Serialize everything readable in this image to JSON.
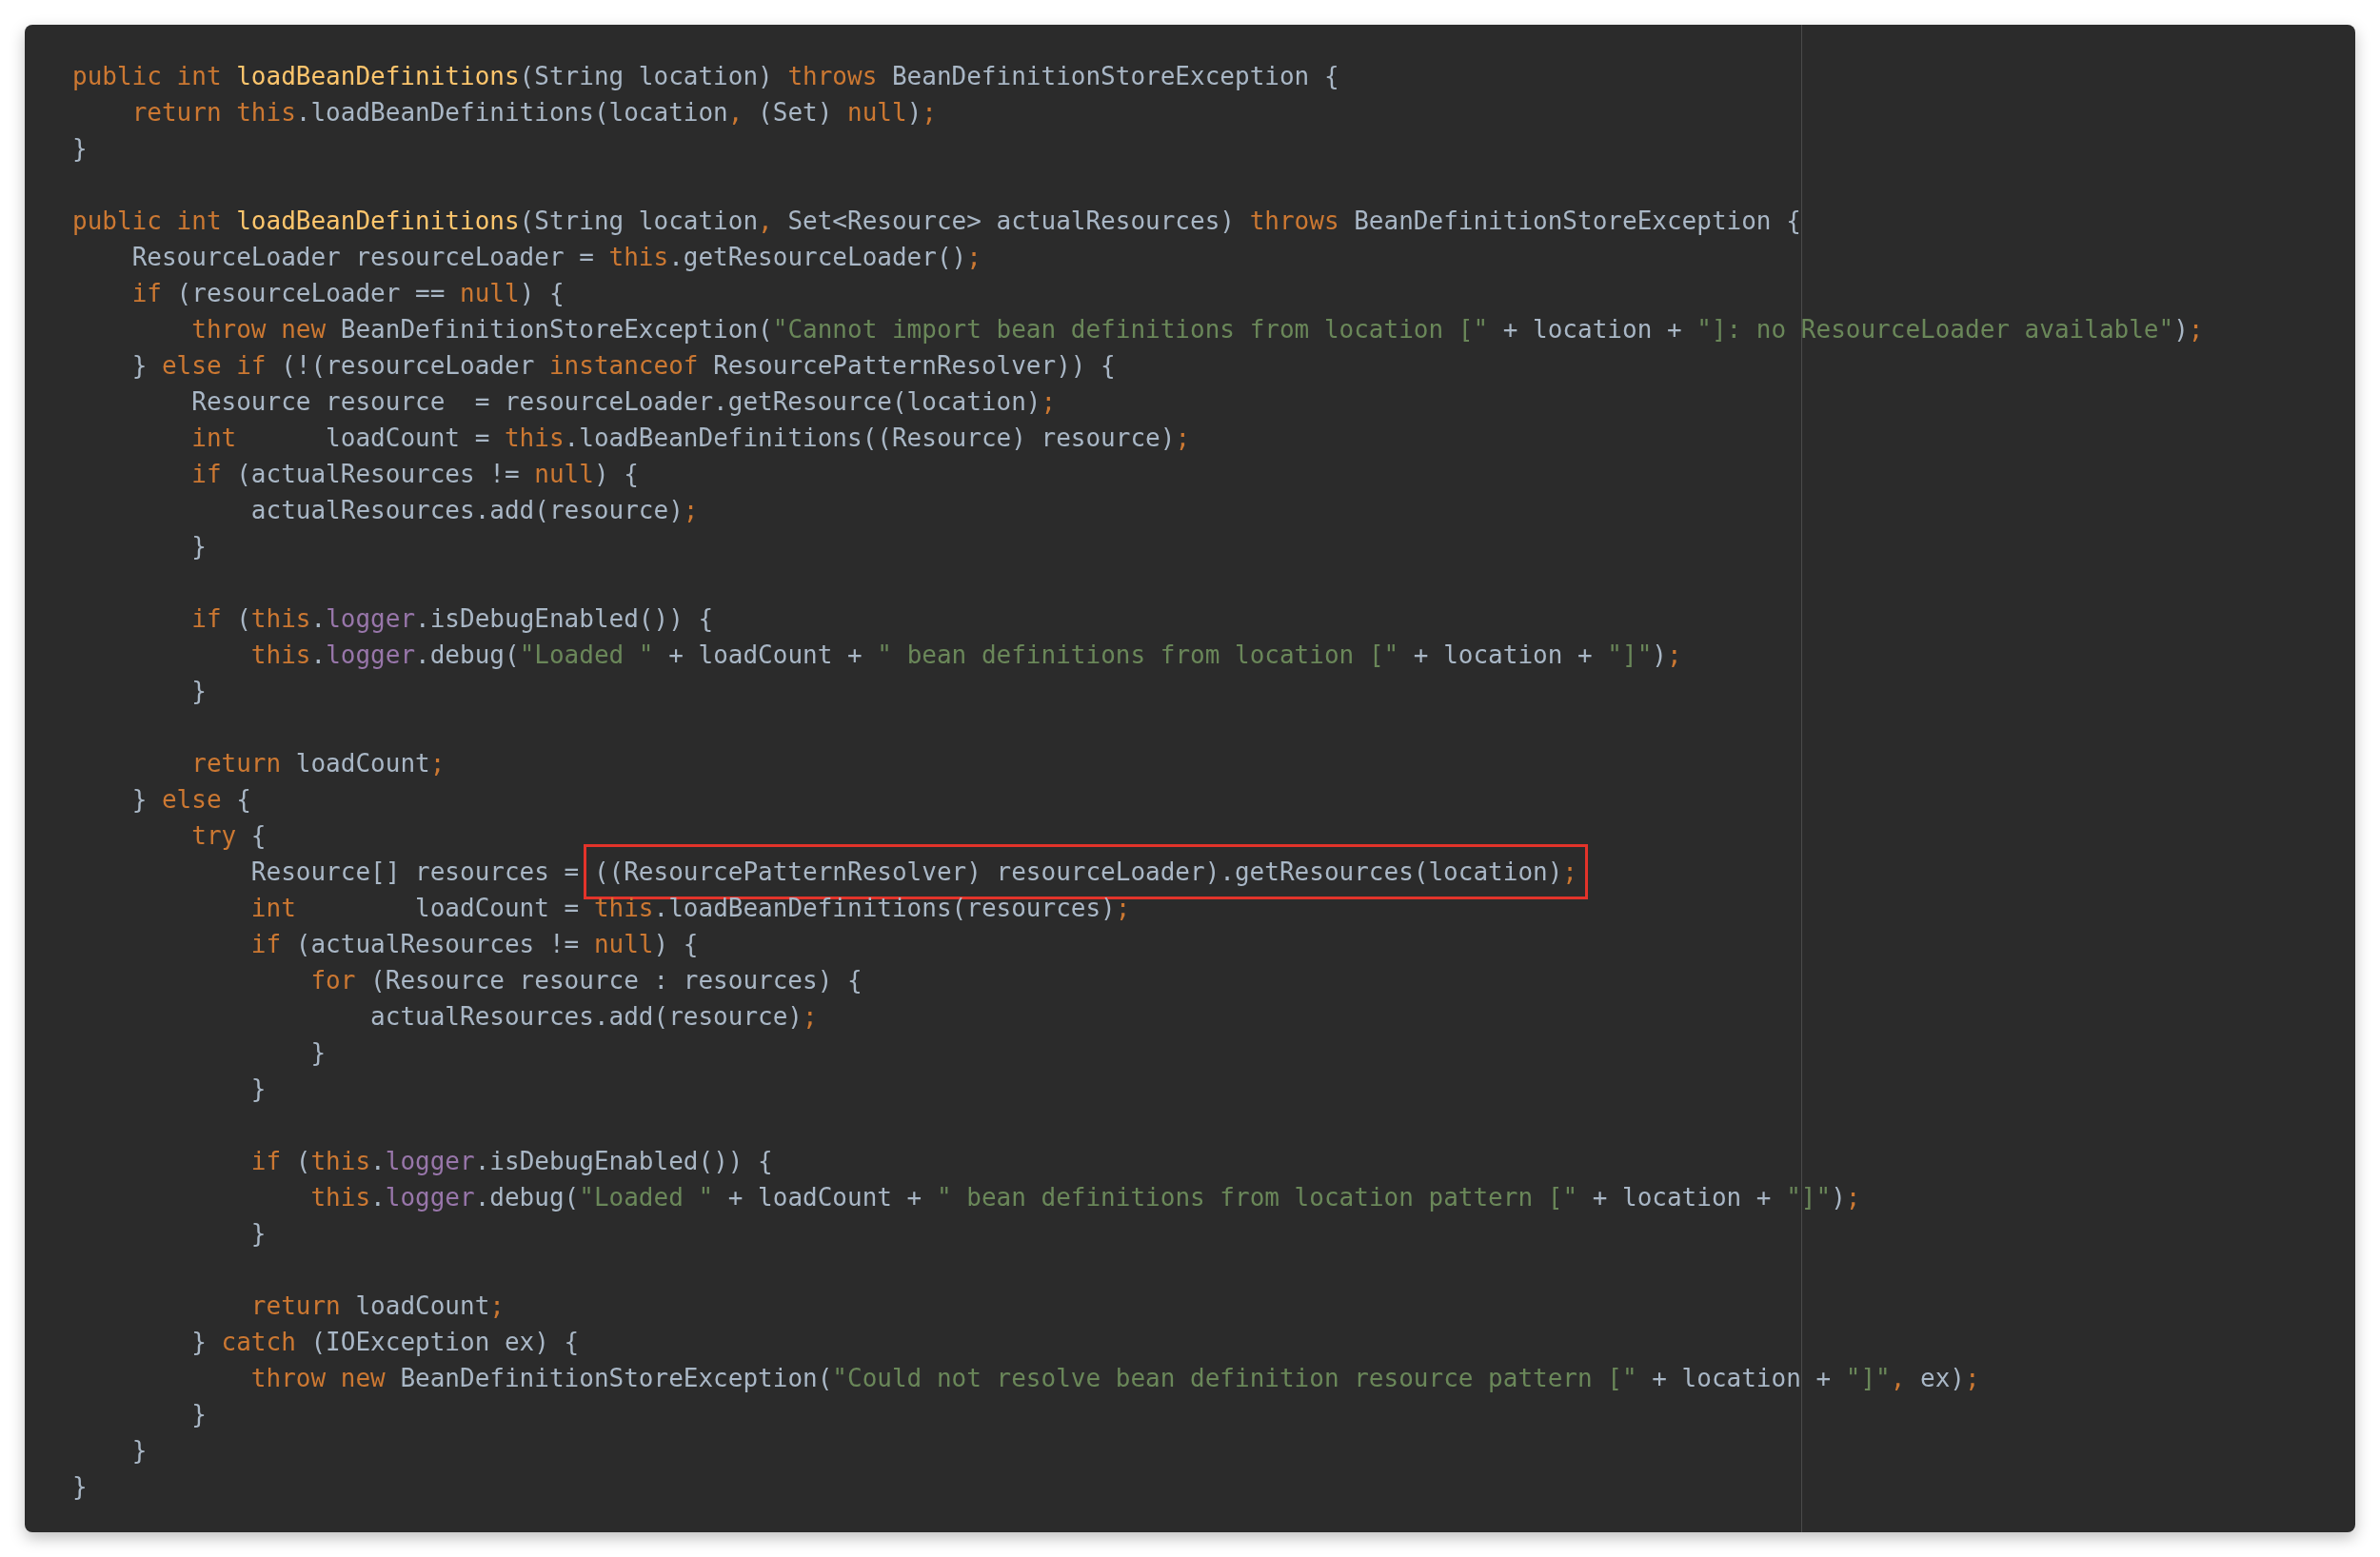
{
  "editor": {
    "lines": [
      {
        "kind": "code",
        "segments": [
          {
            "highlighted": false,
            "tokens": [
              {
                "kind": "keyword",
                "text": "public int "
              },
              {
                "kind": "method",
                "text": "loadBeanDefinitions"
              },
              {
                "kind": "plain",
                "text": "(String location) "
              },
              {
                "kind": "keyword",
                "text": "throws "
              },
              {
                "kind": "plain",
                "text": "BeanDefinitionStoreException {"
              }
            ]
          }
        ]
      },
      {
        "kind": "code",
        "segments": [
          {
            "highlighted": false,
            "tokens": [
              {
                "kind": "keyword",
                "text": "    return this"
              },
              {
                "kind": "plain",
                "text": ".loadBeanDefinitions(location"
              },
              {
                "kind": "keyword",
                "text": ", "
              },
              {
                "kind": "plain",
                "text": "(Set) "
              },
              {
                "kind": "keyword",
                "text": "null"
              },
              {
                "kind": "plain",
                "text": ")"
              },
              {
                "kind": "keyword",
                "text": ";"
              }
            ]
          }
        ]
      },
      {
        "kind": "code",
        "segments": [
          {
            "highlighted": false,
            "tokens": [
              {
                "kind": "plain",
                "text": "}"
              }
            ]
          }
        ]
      },
      {
        "kind": "blank"
      },
      {
        "kind": "code",
        "segments": [
          {
            "highlighted": false,
            "tokens": [
              {
                "kind": "keyword",
                "text": "public int "
              },
              {
                "kind": "method",
                "text": "loadBeanDefinitions"
              },
              {
                "kind": "plain",
                "text": "(String location"
              },
              {
                "kind": "keyword",
                "text": ", "
              },
              {
                "kind": "plain",
                "text": "Set<Resource> actualResources) "
              },
              {
                "kind": "keyword",
                "text": "throws "
              },
              {
                "kind": "plain",
                "text": "BeanDefinitionStoreException {"
              }
            ]
          }
        ]
      },
      {
        "kind": "code",
        "segments": [
          {
            "highlighted": false,
            "tokens": [
              {
                "kind": "plain",
                "text": "    ResourceLoader resourceLoader = "
              },
              {
                "kind": "keyword",
                "text": "this"
              },
              {
                "kind": "plain",
                "text": ".getResourceLoader()"
              },
              {
                "kind": "keyword",
                "text": ";"
              }
            ]
          }
        ]
      },
      {
        "kind": "code",
        "segments": [
          {
            "highlighted": false,
            "tokens": [
              {
                "kind": "keyword",
                "text": "    if "
              },
              {
                "kind": "plain",
                "text": "(resourceLoader == "
              },
              {
                "kind": "keyword",
                "text": "null"
              },
              {
                "kind": "plain",
                "text": ") {"
              }
            ]
          }
        ]
      },
      {
        "kind": "code",
        "segments": [
          {
            "highlighted": false,
            "tokens": [
              {
                "kind": "keyword",
                "text": "        throw new "
              },
              {
                "kind": "plain",
                "text": "BeanDefinitionStoreException("
              },
              {
                "kind": "string",
                "text": "\"Cannot import bean definitions from location [\""
              },
              {
                "kind": "plain",
                "text": " + location + "
              },
              {
                "kind": "string",
                "text": "\"]: no ResourceLoader available\""
              },
              {
                "kind": "plain",
                "text": ")"
              },
              {
                "kind": "keyword",
                "text": ";"
              }
            ]
          }
        ]
      },
      {
        "kind": "code",
        "segments": [
          {
            "highlighted": false,
            "tokens": [
              {
                "kind": "plain",
                "text": "    } "
              },
              {
                "kind": "keyword",
                "text": "else if "
              },
              {
                "kind": "plain",
                "text": "(!(resourceLoader "
              },
              {
                "kind": "keyword",
                "text": "instanceof "
              },
              {
                "kind": "plain",
                "text": "ResourcePatternResolver)) {"
              }
            ]
          }
        ]
      },
      {
        "kind": "code",
        "segments": [
          {
            "highlighted": false,
            "tokens": [
              {
                "kind": "plain",
                "text": "        Resource resource  = resourceLoader.getResource(location)"
              },
              {
                "kind": "keyword",
                "text": ";"
              }
            ]
          }
        ]
      },
      {
        "kind": "code",
        "segments": [
          {
            "highlighted": false,
            "tokens": [
              {
                "kind": "keyword",
                "text": "        int"
              },
              {
                "kind": "plain",
                "text": "      loadCount = "
              },
              {
                "kind": "keyword",
                "text": "this"
              },
              {
                "kind": "plain",
                "text": ".loadBeanDefinitions((Resource) resource)"
              },
              {
                "kind": "keyword",
                "text": ";"
              }
            ]
          }
        ]
      },
      {
        "kind": "code",
        "segments": [
          {
            "highlighted": false,
            "tokens": [
              {
                "kind": "keyword",
                "text": "        if "
              },
              {
                "kind": "plain",
                "text": "(actualResources != "
              },
              {
                "kind": "keyword",
                "text": "null"
              },
              {
                "kind": "plain",
                "text": ") {"
              }
            ]
          }
        ]
      },
      {
        "kind": "code",
        "segments": [
          {
            "highlighted": false,
            "tokens": [
              {
                "kind": "plain",
                "text": "            actualResources.add(resource)"
              },
              {
                "kind": "keyword",
                "text": ";"
              }
            ]
          }
        ]
      },
      {
        "kind": "code",
        "segments": [
          {
            "highlighted": false,
            "tokens": [
              {
                "kind": "plain",
                "text": "        }"
              }
            ]
          }
        ]
      },
      {
        "kind": "blank"
      },
      {
        "kind": "code",
        "segments": [
          {
            "highlighted": false,
            "tokens": [
              {
                "kind": "keyword",
                "text": "        if "
              },
              {
                "kind": "plain",
                "text": "("
              },
              {
                "kind": "keyword",
                "text": "this"
              },
              {
                "kind": "plain",
                "text": "."
              },
              {
                "kind": "field",
                "text": "logger"
              },
              {
                "kind": "plain",
                "text": ".isDebugEnabled()) {"
              }
            ]
          }
        ]
      },
      {
        "kind": "code",
        "segments": [
          {
            "highlighted": false,
            "tokens": [
              {
                "kind": "keyword",
                "text": "            this"
              },
              {
                "kind": "plain",
                "text": "."
              },
              {
                "kind": "field",
                "text": "logger"
              },
              {
                "kind": "plain",
                "text": ".debug("
              },
              {
                "kind": "string",
                "text": "\"Loaded \""
              },
              {
                "kind": "plain",
                "text": " + loadCount + "
              },
              {
                "kind": "string",
                "text": "\" bean definitions from location [\""
              },
              {
                "kind": "plain",
                "text": " + location + "
              },
              {
                "kind": "string",
                "text": "\"]\""
              },
              {
                "kind": "plain",
                "text": ")"
              },
              {
                "kind": "keyword",
                "text": ";"
              }
            ]
          }
        ]
      },
      {
        "kind": "code",
        "segments": [
          {
            "highlighted": false,
            "tokens": [
              {
                "kind": "plain",
                "text": "        }"
              }
            ]
          }
        ]
      },
      {
        "kind": "blank"
      },
      {
        "kind": "code",
        "segments": [
          {
            "highlighted": false,
            "tokens": [
              {
                "kind": "keyword",
                "text": "        return "
              },
              {
                "kind": "plain",
                "text": "loadCount"
              },
              {
                "kind": "keyword",
                "text": ";"
              }
            ]
          }
        ]
      },
      {
        "kind": "code",
        "segments": [
          {
            "highlighted": false,
            "tokens": [
              {
                "kind": "plain",
                "text": "    } "
              },
              {
                "kind": "keyword",
                "text": "else "
              },
              {
                "kind": "plain",
                "text": "{"
              }
            ]
          }
        ]
      },
      {
        "kind": "code",
        "segments": [
          {
            "highlighted": false,
            "tokens": [
              {
                "kind": "keyword",
                "text": "        try "
              },
              {
                "kind": "plain",
                "text": "{"
              }
            ]
          }
        ]
      },
      {
        "kind": "code",
        "segments": [
          {
            "highlighted": false,
            "tokens": [
              {
                "kind": "plain",
                "text": "            Resource[] resources = "
              }
            ]
          },
          {
            "highlighted": true,
            "tokens": [
              {
                "kind": "plain",
                "text": "((ResourcePatternResolver) resourceLoader).getResources(location)"
              },
              {
                "kind": "keyword",
                "text": ";"
              }
            ]
          }
        ]
      },
      {
        "kind": "code",
        "segments": [
          {
            "highlighted": false,
            "tokens": [
              {
                "kind": "keyword",
                "text": "            int"
              },
              {
                "kind": "plain",
                "text": "        loadCount = "
              },
              {
                "kind": "keyword",
                "text": "this"
              },
              {
                "kind": "plain",
                "text": ".loadBeanDefinitions(resources)"
              },
              {
                "kind": "keyword",
                "text": ";"
              }
            ]
          }
        ]
      },
      {
        "kind": "code",
        "segments": [
          {
            "highlighted": false,
            "tokens": [
              {
                "kind": "keyword",
                "text": "            if "
              },
              {
                "kind": "plain",
                "text": "(actualResources != "
              },
              {
                "kind": "keyword",
                "text": "null"
              },
              {
                "kind": "plain",
                "text": ") {"
              }
            ]
          }
        ]
      },
      {
        "kind": "code",
        "segments": [
          {
            "highlighted": false,
            "tokens": [
              {
                "kind": "keyword",
                "text": "                for "
              },
              {
                "kind": "plain",
                "text": "(Resource resource : resources) {"
              }
            ]
          }
        ]
      },
      {
        "kind": "code",
        "segments": [
          {
            "highlighted": false,
            "tokens": [
              {
                "kind": "plain",
                "text": "                    actualResources.add(resource)"
              },
              {
                "kind": "keyword",
                "text": ";"
              }
            ]
          }
        ]
      },
      {
        "kind": "code",
        "segments": [
          {
            "highlighted": false,
            "tokens": [
              {
                "kind": "plain",
                "text": "                }"
              }
            ]
          }
        ]
      },
      {
        "kind": "code",
        "segments": [
          {
            "highlighted": false,
            "tokens": [
              {
                "kind": "plain",
                "text": "            }"
              }
            ]
          }
        ]
      },
      {
        "kind": "blank"
      },
      {
        "kind": "code",
        "segments": [
          {
            "highlighted": false,
            "tokens": [
              {
                "kind": "keyword",
                "text": "            if "
              },
              {
                "kind": "plain",
                "text": "("
              },
              {
                "kind": "keyword",
                "text": "this"
              },
              {
                "kind": "plain",
                "text": "."
              },
              {
                "kind": "field",
                "text": "logger"
              },
              {
                "kind": "plain",
                "text": ".isDebugEnabled()) {"
              }
            ]
          }
        ]
      },
      {
        "kind": "code",
        "segments": [
          {
            "highlighted": false,
            "tokens": [
              {
                "kind": "keyword",
                "text": "                this"
              },
              {
                "kind": "plain",
                "text": "."
              },
              {
                "kind": "field",
                "text": "logger"
              },
              {
                "kind": "plain",
                "text": ".debug("
              },
              {
                "kind": "string",
                "text": "\"Loaded \""
              },
              {
                "kind": "plain",
                "text": " + loadCount + "
              },
              {
                "kind": "string",
                "text": "\" bean definitions from location pattern [\""
              },
              {
                "kind": "plain",
                "text": " + location + "
              },
              {
                "kind": "string",
                "text": "\"]\""
              },
              {
                "kind": "plain",
                "text": ")"
              },
              {
                "kind": "keyword",
                "text": ";"
              }
            ]
          }
        ]
      },
      {
        "kind": "code",
        "segments": [
          {
            "highlighted": false,
            "tokens": [
              {
                "kind": "plain",
                "text": "            }"
              }
            ]
          }
        ]
      },
      {
        "kind": "blank"
      },
      {
        "kind": "code",
        "segments": [
          {
            "highlighted": false,
            "tokens": [
              {
                "kind": "keyword",
                "text": "            return "
              },
              {
                "kind": "plain",
                "text": "loadCount"
              },
              {
                "kind": "keyword",
                "text": ";"
              }
            ]
          }
        ]
      },
      {
        "kind": "code",
        "segments": [
          {
            "highlighted": false,
            "tokens": [
              {
                "kind": "plain",
                "text": "        } "
              },
              {
                "kind": "keyword",
                "text": "catch "
              },
              {
                "kind": "plain",
                "text": "(IOException ex) {"
              }
            ]
          }
        ]
      },
      {
        "kind": "code",
        "segments": [
          {
            "highlighted": false,
            "tokens": [
              {
                "kind": "keyword",
                "text": "            throw new "
              },
              {
                "kind": "plain",
                "text": "BeanDefinitionStoreException("
              },
              {
                "kind": "string",
                "text": "\"Could not resolve bean definition resource pattern [\""
              },
              {
                "kind": "plain",
                "text": " + location + "
              },
              {
                "kind": "string",
                "text": "\"]\""
              },
              {
                "kind": "keyword",
                "text": ", "
              },
              {
                "kind": "plain",
                "text": "ex)"
              },
              {
                "kind": "keyword",
                "text": ";"
              }
            ]
          }
        ]
      },
      {
        "kind": "code",
        "segments": [
          {
            "highlighted": false,
            "tokens": [
              {
                "kind": "plain",
                "text": "        }"
              }
            ]
          }
        ]
      },
      {
        "kind": "code",
        "segments": [
          {
            "highlighted": false,
            "tokens": [
              {
                "kind": "plain",
                "text": "    }"
              }
            ]
          }
        ]
      },
      {
        "kind": "code",
        "segments": [
          {
            "highlighted": false,
            "tokens": [
              {
                "kind": "plain",
                "text": "}"
              }
            ]
          }
        ]
      }
    ]
  }
}
